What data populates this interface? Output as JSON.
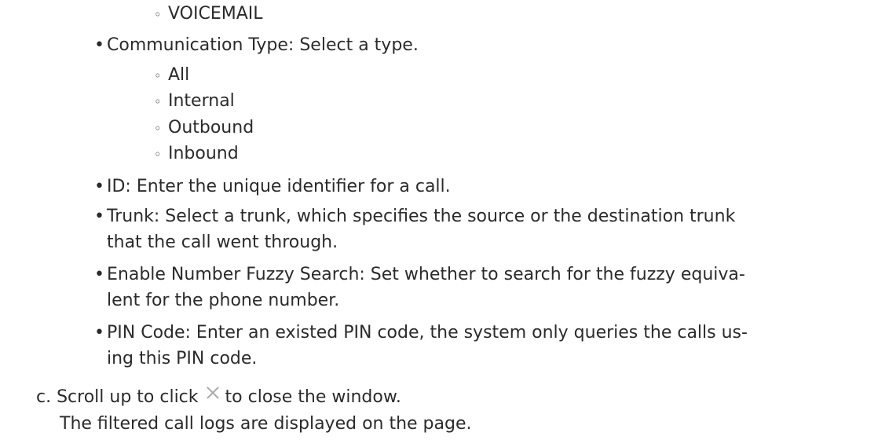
{
  "content": {
    "voicemail": "VOICEMAIL",
    "communication_type": "Communication Type: Select a type.",
    "comm_types": [
      "All",
      "Internal",
      "Outbound",
      "Inbound"
    ],
    "id_line": "ID: Enter the unique identifier for a call.",
    "trunk_line_1": "Trunk: Select a trunk, which specifies the source or the destination trunk",
    "trunk_line_2": "that the call went through.",
    "fuzzy_line_1": "Enable Number Fuzzy Search: Set whether to search for the fuzzy equiva-",
    "fuzzy_line_2": "lent for the phone number.",
    "pin_line_1": "PIN Code: Enter an existed PIN code, the system only queries the calls us-",
    "pin_line_2": "ing this PIN code.",
    "step_c_before": "c. Scroll up to click",
    "step_c_after": "to close the window.",
    "result_line": "The filtered call logs are displayed on the page."
  },
  "icons": {
    "close": "close-icon",
    "bullet": "•",
    "sub_bullet": "◦"
  },
  "colors": {
    "text": "#2b2b2b",
    "icon": "#a9a9a9"
  }
}
